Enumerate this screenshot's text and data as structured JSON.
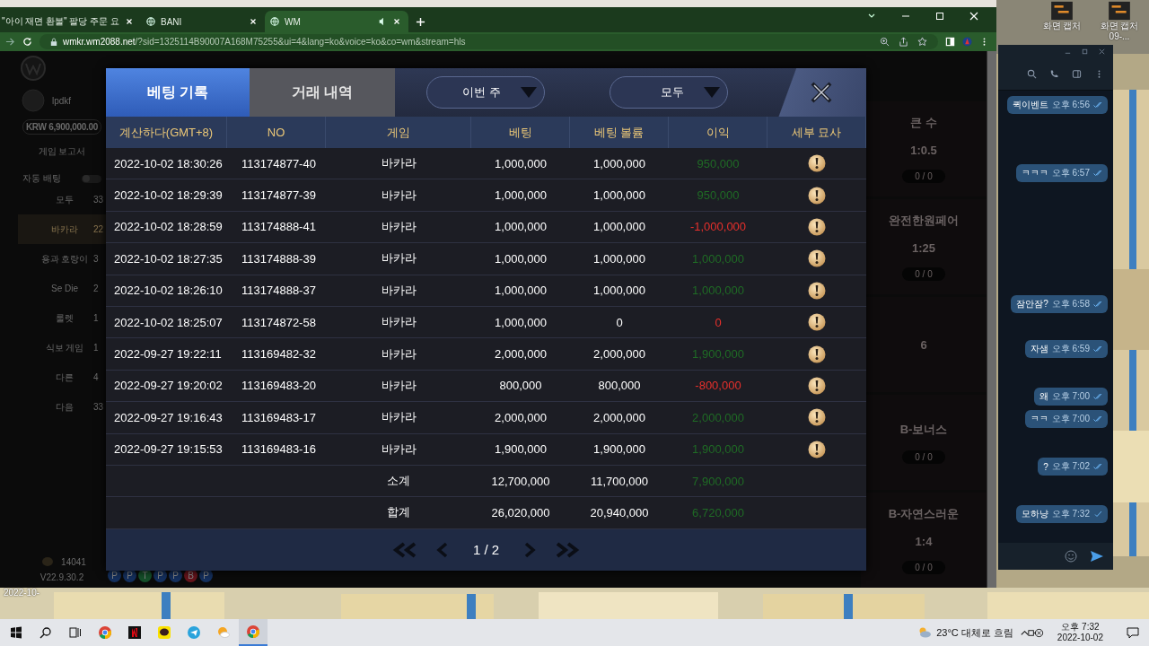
{
  "browser": {
    "tabs": [
      {
        "title": "\"아이 재면 환불\" 팔당 주문 요",
        "selected": false
      },
      {
        "title": "BANI",
        "selected": false
      },
      {
        "title": "WM",
        "selected": true
      }
    ],
    "url_host": "wmkr.wm2088.net",
    "url_path": "/?sid=1325114B90007A168M75255&ui=4&lang=ko&voice=ko&co=wm&stream=hls"
  },
  "sidebar": {
    "user": "lpdkf",
    "balance": "KRW 6,900,000.00",
    "report": "게임 보고서",
    "auto_bet": {
      "label": "자동 배팅",
      "on": false
    },
    "items": [
      {
        "label": "모두",
        "count": "33",
        "selected": false
      },
      {
        "label": "바카라",
        "count": "22",
        "selected": true
      },
      {
        "label": "용과 호랑이",
        "count": "3",
        "selected": false
      },
      {
        "label": "Se Die",
        "count": "2",
        "selected": false
      },
      {
        "label": "룰렛",
        "count": "1",
        "selected": false
      },
      {
        "label": "식보 게임",
        "count": "1",
        "selected": false
      },
      {
        "label": "다른",
        "count": "4",
        "selected": false
      },
      {
        "label": "다음",
        "count": "33",
        "selected": false
      }
    ],
    "points": "14041",
    "version": "V22.9.30.2"
  },
  "side_cards": [
    {
      "title": "큰 수",
      "odds": "1:0.5",
      "bets": "0 / 0"
    },
    {
      "title": "완전한원페어",
      "odds": "1:25",
      "bets": "0 / 0"
    },
    {
      "odds": "6"
    },
    {
      "title": "B-보너스",
      "bets": "0 / 0"
    },
    {
      "title": "B-자연스러운",
      "odds": "1:4",
      "bets": "0 / 0"
    }
  ],
  "road": [
    {
      "letter": "P",
      "color": "#14305e"
    },
    {
      "letter": "P",
      "color": "#14305e"
    },
    {
      "letter": "T",
      "color": "#15502a"
    },
    {
      "letter": "P",
      "color": "#14305e"
    },
    {
      "letter": "P",
      "color": "#14305e"
    },
    {
      "letter": "B",
      "color": "#66141b"
    },
    {
      "letter": "P",
      "color": "#14305e"
    }
  ],
  "modal": {
    "tabs": [
      {
        "label": "베팅 기록",
        "selected": true
      },
      {
        "label": "거래 내역",
        "selected": false
      }
    ],
    "filters": [
      "이번 주",
      "모두"
    ],
    "columns": [
      "계산하다(GMT+8)",
      "NO",
      "게임",
      "베팅",
      "베팅 볼륨",
      "이익",
      "세부 묘사"
    ],
    "rows": [
      {
        "time": "2022-10-02 18:30:26",
        "no": "113174877-40",
        "game": "바카라",
        "bet": "1,000,000",
        "volume": "1,000,000",
        "profit": "950,000",
        "color": "#1f6b25"
      },
      {
        "time": "2022-10-02 18:29:39",
        "no": "113174877-39",
        "game": "바카라",
        "bet": "1,000,000",
        "volume": "1,000,000",
        "profit": "950,000",
        "color": "#1f6b25"
      },
      {
        "time": "2022-10-02 18:28:59",
        "no": "113174888-41",
        "game": "바카라",
        "bet": "1,000,000",
        "volume": "1,000,000",
        "profit": "-1,000,000",
        "color": "#e8302c"
      },
      {
        "time": "2022-10-02 18:27:35",
        "no": "113174888-39",
        "game": "바카라",
        "bet": "1,000,000",
        "volume": "1,000,000",
        "profit": "1,000,000",
        "color": "#1f6b25"
      },
      {
        "time": "2022-10-02 18:26:10",
        "no": "113174888-37",
        "game": "바카라",
        "bet": "1,000,000",
        "volume": "1,000,000",
        "profit": "1,000,000",
        "color": "#1f6b25"
      },
      {
        "time": "2022-10-02 18:25:07",
        "no": "113174872-58",
        "game": "바카라",
        "bet": "1,000,000",
        "volume": "0",
        "profit": "0",
        "color": "#e8302c"
      },
      {
        "time": "2022-09-27 19:22:11",
        "no": "113169482-32",
        "game": "바카라",
        "bet": "2,000,000",
        "volume": "2,000,000",
        "profit": "1,900,000",
        "color": "#1f6b25"
      },
      {
        "time": "2022-09-27 19:20:02",
        "no": "113169483-20",
        "game": "바카라",
        "bet": "800,000",
        "volume": "800,000",
        "profit": "-800,000",
        "color": "#e8302c"
      },
      {
        "time": "2022-09-27 19:16:43",
        "no": "113169483-17",
        "game": "바카라",
        "bet": "2,000,000",
        "volume": "2,000,000",
        "profit": "2,000,000",
        "color": "#1f6b25"
      },
      {
        "time": "2022-09-27 19:15:53",
        "no": "113169483-16",
        "game": "바카라",
        "bet": "1,900,000",
        "volume": "1,900,000",
        "profit": "1,900,000",
        "color": "#1f6b25"
      }
    ],
    "totals": [
      {
        "label": "소계",
        "bet": "12,700,000",
        "volume": "11,700,000",
        "profit": "7,900,000",
        "color": "#1f6b25"
      },
      {
        "label": "합계",
        "bet": "26,020,000",
        "volume": "20,940,000",
        "profit": "6,720,000",
        "color": "#1f6b25"
      }
    ],
    "page": "1 / 2"
  },
  "chat": {
    "messages": [
      {
        "text": "퀵이벤트",
        "time": "오후 6:56",
        "read": true
      },
      {
        "text": "ㅋㅋㅋ",
        "time": "오후 6:57",
        "read": true
      },
      {
        "text": "잠안잠?",
        "time": "오후 6:58",
        "read": true
      },
      {
        "text": "자샘",
        "time": "오후 6:59",
        "read": true
      },
      {
        "text": "왜",
        "time": "오후 7:00",
        "read": true
      },
      {
        "text": "ㅋㅋ",
        "time": "오후 7:00",
        "read": true
      },
      {
        "text": "?",
        "time": "오후 7:02",
        "read": true
      },
      {
        "text": "모하냥",
        "time": "오후 7:32",
        "read": false
      }
    ]
  },
  "desktop_icons": [
    {
      "label": "화면 캡처"
    },
    {
      "label": "화면 캡처 09-..."
    }
  ],
  "corner_stamp": "2022-10-",
  "taskbar": {
    "weather": "23°C 대체로 흐림",
    "time": "오후 7:32",
    "date": "2022-10-02"
  }
}
